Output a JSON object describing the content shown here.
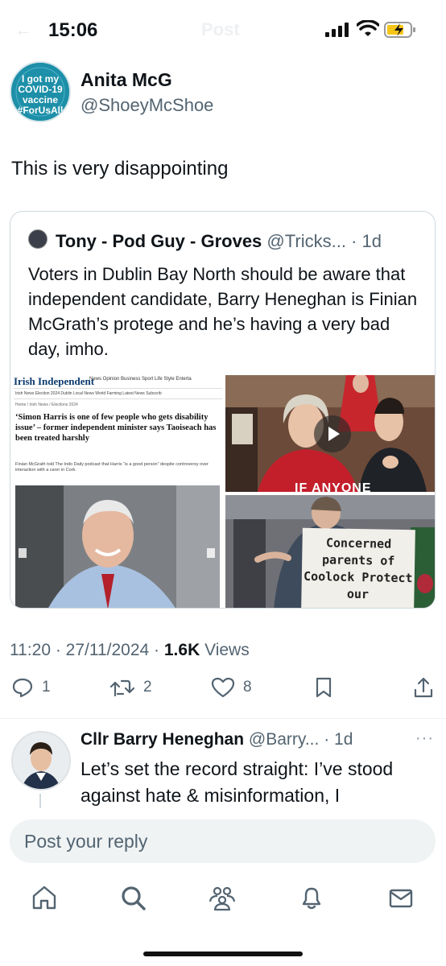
{
  "status_bar": {
    "time": "15:06",
    "back_hint": "←",
    "title_hint": "Post"
  },
  "post": {
    "author_name": "Anita McG",
    "author_handle": "@ShoeyMcShoe",
    "avatar_text": "I got my COVID-19 vaccine #ForUsAll",
    "text": "This is very disappointing",
    "timestamp": "11:20 · 27/11/2024 · ",
    "views_count": "1.6K",
    "views_label": " Views",
    "replies": "1",
    "reposts": "2",
    "likes": "8"
  },
  "quote": {
    "author_name": "Tony - Pod Guy - Groves",
    "author_handle": "@Tricks...",
    "time": "· 1d",
    "text": "Voters in Dublin Bay North should be aware that independent candidate, Barry Heneghan is Finian McGrath’s protege and he’s having a very bad day, imho.",
    "media": {
      "paper_logo": "Irish Independent",
      "paper_nav": "News   Opinion   Business   Sport   Life   Style   Enterta",
      "paper_subnav": "Irish News   Election 2024   Dublin   Local News   World   Farming   Latest News   Subscrib",
      "paper_crumb": "Home / Irish News / Elections 2024",
      "paper_headline": "‘Simon Harris is one of few people who gets disability issue’ – former independent minister says Taoiseach has been treated harshly",
      "paper_standfirst": "Finian McGrath told The Indo Daily podcast that Harris “is a good person” despite controversy over interaction with a carer in Cork.",
      "video_caption": "IF ANYONE",
      "sign_text": "Concerned parents of Coolock Protect our"
    }
  },
  "reply": {
    "author_name": "Cllr Barry Heneghan",
    "author_handle": "@Barry...",
    "time": "· 1d",
    "more": "···",
    "text": "Let’s set the record straight:  I’ve stood against hate & misinformation, I"
  },
  "composer": {
    "placeholder": "Post your reply"
  },
  "icons": [
    "signal-icon",
    "wifi-icon",
    "battery-icon",
    "reply-icon",
    "repost-icon",
    "like-icon",
    "bookmark-icon",
    "share-icon",
    "home-icon",
    "search-icon",
    "communities-icon",
    "notifications-icon",
    "messages-icon"
  ],
  "colors": {
    "text": "#0f1419",
    "secondary": "#536471",
    "border": "#cfd9de",
    "composer_bg": "#eff3f4"
  }
}
